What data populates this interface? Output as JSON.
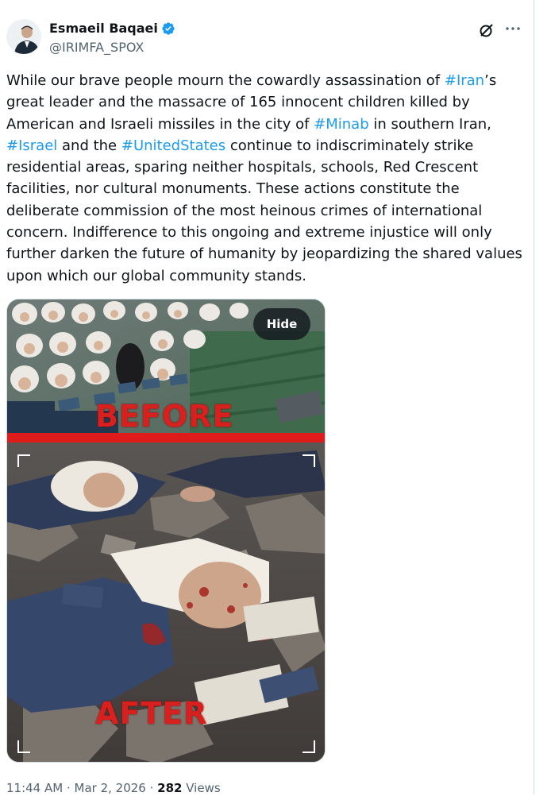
{
  "author": {
    "display_name": "Esmaeil Baqaei",
    "handle": "@IRIMFA_SPOX",
    "verified": true
  },
  "tweet": {
    "segments": [
      {
        "text": "While our brave people mourn the cowardly assassination of ",
        "type": "text"
      },
      {
        "text": "#Iran",
        "type": "hashtag"
      },
      {
        "text": "’s great leader and the massacre of 165 innocent children killed by American and Israeli missiles in the city of ",
        "type": "text"
      },
      {
        "text": "#Minab",
        "type": "hashtag"
      },
      {
        "text": " in southern Iran, ",
        "type": "text"
      },
      {
        "text": "#Israel",
        "type": "hashtag"
      },
      {
        "text": " and the ",
        "type": "text"
      },
      {
        "text": "#UnitedStates",
        "type": "hashtag"
      },
      {
        "text": " continue to indiscriminately strike residential areas, sparing neither hospitals, schools, Red Crescent facilities, nor cultural monuments. These actions constitute the deliberate commission of the most heinous crimes of international concern. Indifference to this ongoing and extreme injustice will only further darken the future of humanity by jeopardizing the shared values upon which our global community stands.",
        "type": "text"
      }
    ]
  },
  "media": {
    "hide_label": "Hide",
    "before_caption": "BEFORE",
    "after_caption": "AFTER"
  },
  "meta": {
    "time": "11:44 AM",
    "separator": " · ",
    "date": "Mar 2, 2026",
    "views_count": "282",
    "views_label": " Views"
  },
  "icons": {
    "grok": "grok-icon",
    "more": "more-icon",
    "verified": "verified-badge-icon"
  },
  "colors": {
    "accent": "#1d9bf0",
    "text": "#0f1419",
    "secondary": "#536471",
    "caption_red": "#d8201f"
  }
}
